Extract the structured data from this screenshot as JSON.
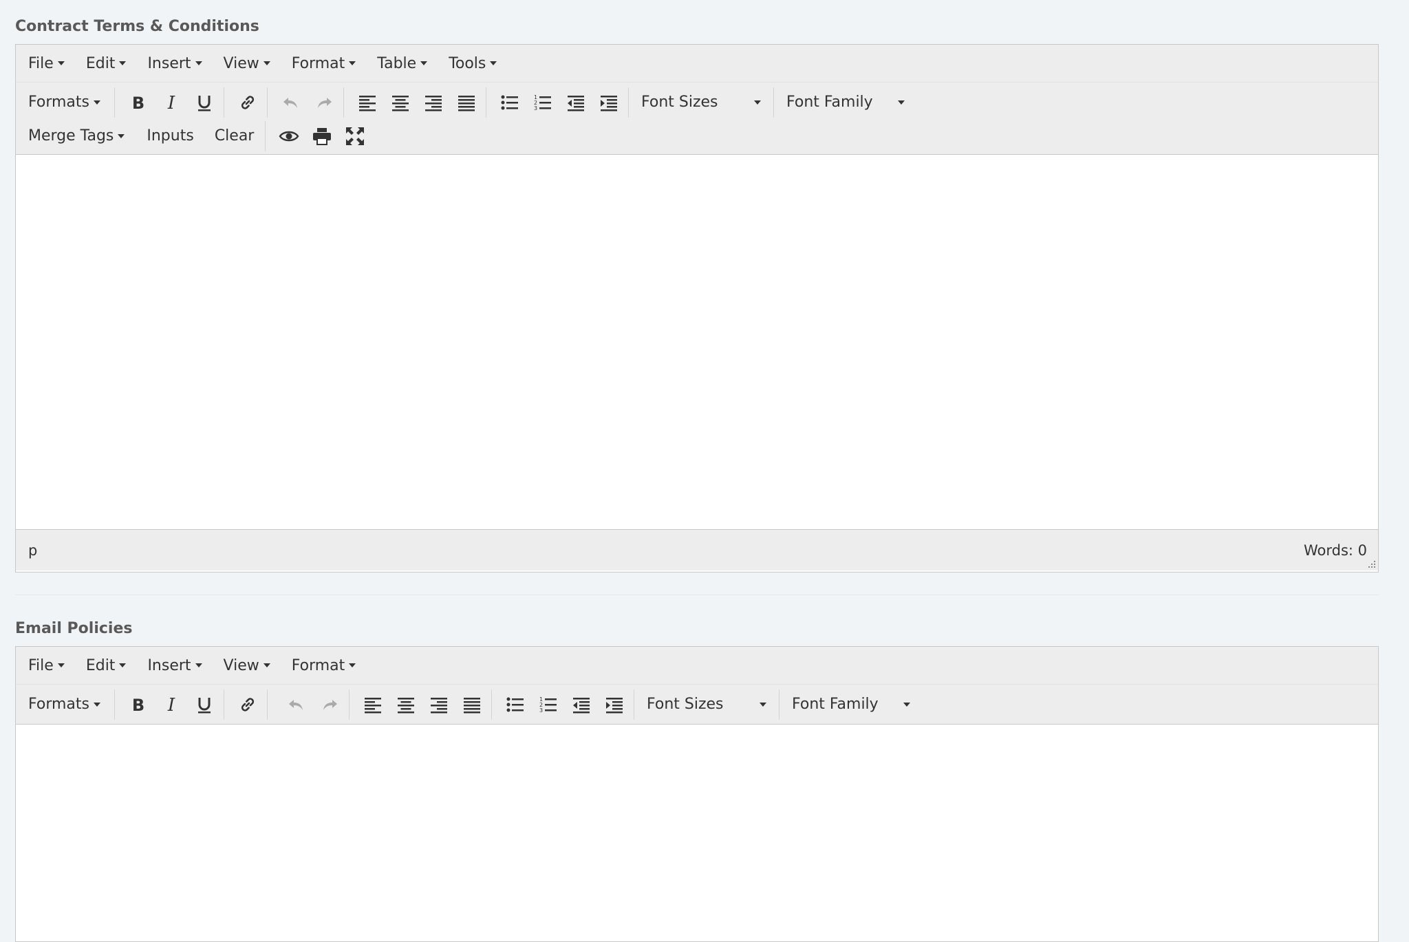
{
  "colors": {
    "page_bg": "#f0f4f7",
    "toolbar_bg": "#ededed",
    "border": "#c8c8c8",
    "text": "#333333",
    "disabled": "#9a9a9a"
  },
  "contract": {
    "label": "Contract Terms & Conditions",
    "menu": [
      "File",
      "Edit",
      "Insert",
      "View",
      "Format",
      "Table",
      "Tools"
    ],
    "formats_label": "Formats",
    "font_sizes_label": "Font Sizes",
    "font_family_label": "Font Family",
    "merge_tags_label": "Merge Tags",
    "inputs_label": "Inputs",
    "clear_label": "Clear",
    "status_path": "p",
    "word_count": "Words: 0"
  },
  "email": {
    "label": "Email Policies",
    "menu": [
      "File",
      "Edit",
      "Insert",
      "View",
      "Format"
    ],
    "formats_label": "Formats",
    "font_sizes_label": "Font Sizes",
    "font_family_label": "Font Family"
  },
  "icons": [
    "bold-icon",
    "italic-icon",
    "underline-icon",
    "link-icon",
    "undo-icon",
    "redo-icon",
    "align-left-icon",
    "align-center-icon",
    "align-right-icon",
    "align-justify-icon",
    "bullet-list-icon",
    "numbered-list-icon",
    "outdent-icon",
    "indent-icon",
    "preview-icon",
    "print-icon",
    "fullscreen-icon"
  ]
}
